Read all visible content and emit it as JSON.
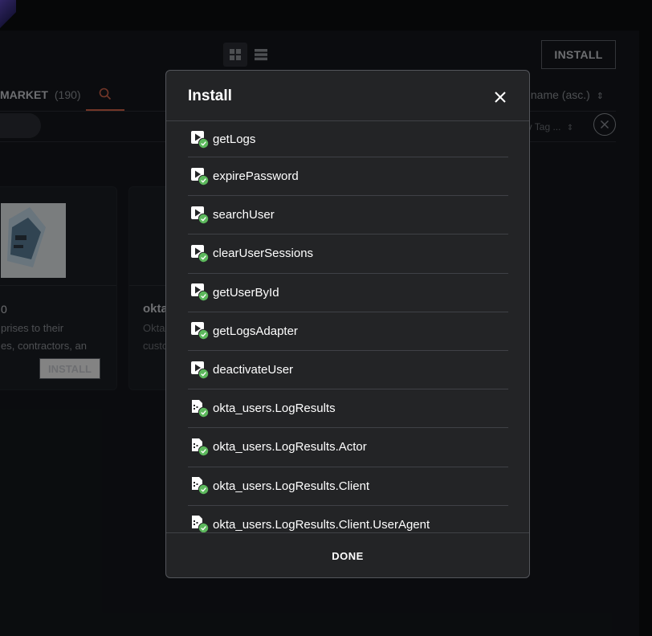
{
  "background": {
    "install_button_label": "INSTALL",
    "tabs": {
      "market_label": "MARKET",
      "market_count": "(190)"
    },
    "sort_label": "y name (asc.)",
    "tag_filter_label": "by Tag ...",
    "cards": [
      {
        "number": "0",
        "description_line1": "prises to their",
        "description_line2": "es, contractors, an",
        "install_label": "INSTALL"
      },
      {
        "title": "okta",
        "description_line1": "Okta",
        "description_line2": "custo"
      }
    ]
  },
  "modal": {
    "title": "Install",
    "done_label": "DONE",
    "items": [
      {
        "label": "getLogs",
        "icon": "playbook-installed-icon"
      },
      {
        "label": "expirePassword",
        "icon": "playbook-installed-icon"
      },
      {
        "label": "searchUser",
        "icon": "playbook-installed-icon"
      },
      {
        "label": "clearUserSessions",
        "icon": "playbook-installed-icon"
      },
      {
        "label": "getUserById",
        "icon": "playbook-installed-icon"
      },
      {
        "label": "getLogsAdapter",
        "icon": "playbook-installed-icon"
      },
      {
        "label": "deactivateUser",
        "icon": "playbook-installed-icon"
      },
      {
        "label": "okta_users.LogResults",
        "icon": "datatype-installed-icon"
      },
      {
        "label": "okta_users.LogResults.Actor",
        "icon": "datatype-installed-icon"
      },
      {
        "label": "okta_users.LogResults.Client",
        "icon": "datatype-installed-icon"
      },
      {
        "label": "okta_users.LogResults.Client.UserAgent",
        "icon": "datatype-installed-icon"
      }
    ]
  },
  "colors": {
    "success_green": "#5cb85c",
    "accent_orange": "#d2634a",
    "modal_bg": "#232426"
  }
}
